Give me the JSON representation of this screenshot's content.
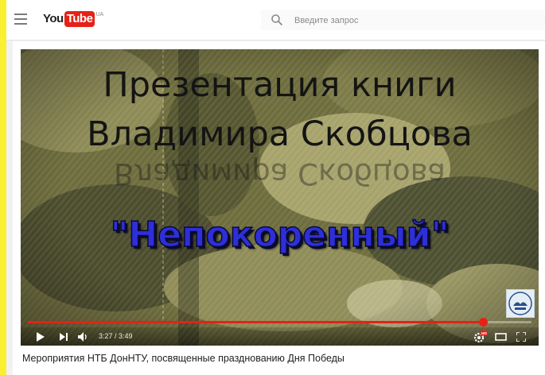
{
  "header": {
    "logo_you": "You",
    "logo_tube": "Tube",
    "logo_region": "UA",
    "search_placeholder": "Введите запрос"
  },
  "video": {
    "title_line1": "Презентация книги",
    "title_line2": "Владимира Скобцова",
    "reflection_text": "Владимира Скобцова",
    "book_title": "\"Непокоренный\"",
    "current_time": "3:27",
    "duration": "3:49",
    "time_display": "3:27 / 3:49",
    "progress_fraction": 0.904,
    "hd_badge": "HD"
  },
  "caption": "Мероприятия НТБ ДонНТУ, посвященные празднованию Дня Победы",
  "colors": {
    "outer_background": "#fbef32",
    "brand_red": "#e62117",
    "book_title_blue": "#2d2fd8"
  },
  "icons": [
    "menu-icon",
    "search-icon",
    "play-icon",
    "next-icon",
    "volume-icon",
    "settings-icon",
    "theater-mode-icon",
    "fullscreen-icon"
  ]
}
